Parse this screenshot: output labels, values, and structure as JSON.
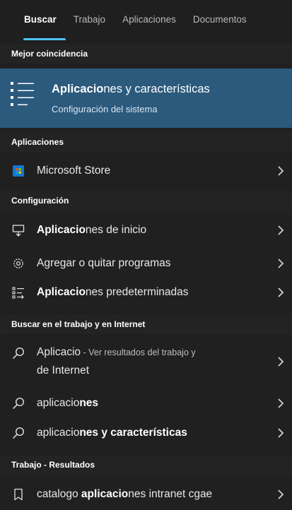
{
  "tabs": [
    "Buscar",
    "Trabajo",
    "Aplicaciones",
    "Documentos"
  ],
  "best_match": {
    "header": "Mejor coincidencia",
    "title_bold": "Aplicacio",
    "title_rest": "nes y características",
    "subtitle": "Configuración del sistema"
  },
  "apps": {
    "header": "Aplicaciones",
    "items": [
      {
        "label": "Microsoft Store"
      }
    ]
  },
  "settings": {
    "header": "Configuración",
    "items": [
      {
        "bold": "Aplicacio",
        "rest": "nes de inicio"
      },
      {
        "bold": "",
        "rest": "Agregar o quitar programas"
      },
      {
        "bold": "Aplicacio",
        "rest": "nes predeterminadas"
      }
    ]
  },
  "web": {
    "header": "Buscar en el trabajo y en Internet",
    "items": [
      {
        "main": "Aplicacio",
        "detail_1": " - Ver resultados del trabajo y",
        "detail_2": "de Internet"
      },
      {
        "plain": "aplicacio",
        "bold": "nes"
      },
      {
        "plain": "aplicacio",
        "bold": "nes y características"
      }
    ]
  },
  "work": {
    "header": "Trabajo - Resultados",
    "items": [
      {
        "plain_1": "catalogo ",
        "bold": "aplicacio",
        "plain_2": "nes intranet cgae"
      }
    ]
  },
  "colors": {
    "background": "#202020",
    "best_match_highlight": "#2b5a7d",
    "accent": "#4cc2ff"
  },
  "icons": {
    "best_match": "list-settings-icon",
    "microsoft_store": "microsoft-store-icon",
    "startup_apps": "startup-icon",
    "add_remove": "gear-icon",
    "default_apps": "default-apps-icon",
    "search": "search-icon",
    "file": "document-icon",
    "chevron": "chevron-right-icon"
  }
}
